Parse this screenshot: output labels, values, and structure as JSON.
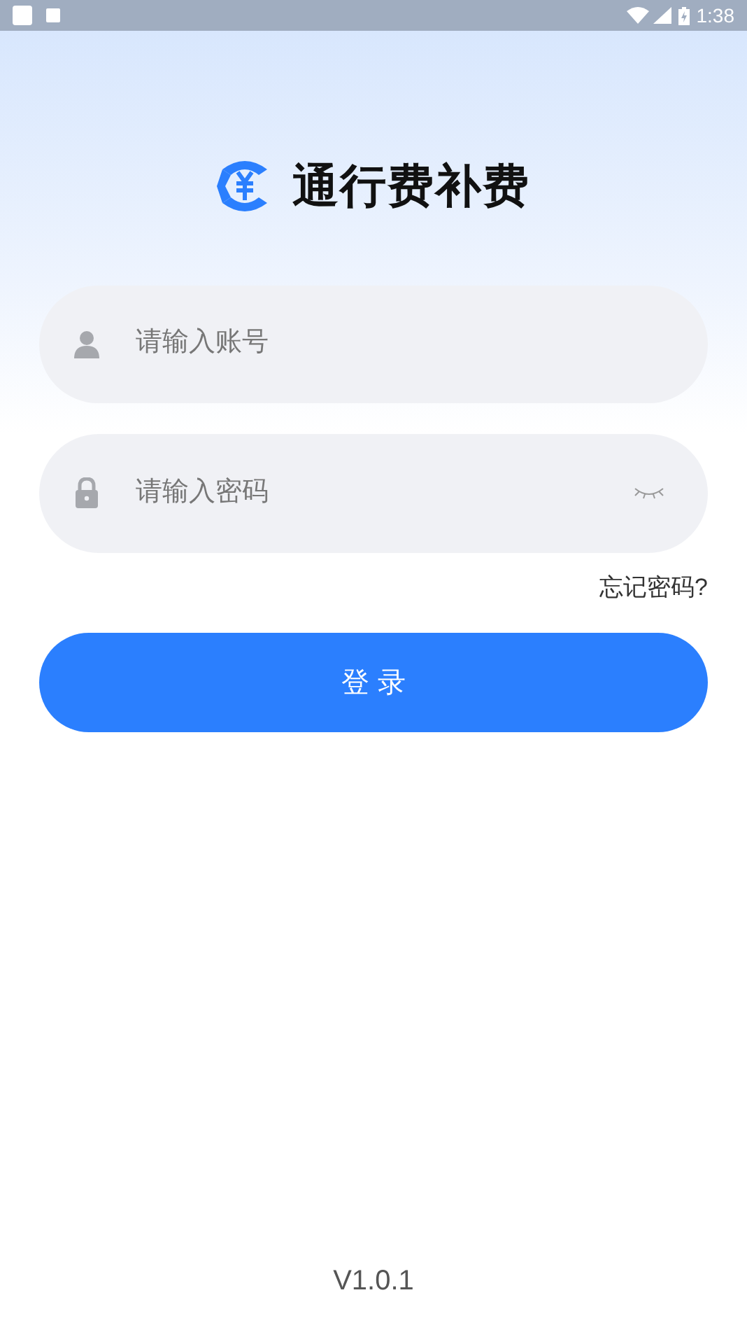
{
  "status_bar": {
    "time": "1:38"
  },
  "app_title": "通行费补费",
  "account_field": {
    "placeholder": "请输入账号"
  },
  "password_field": {
    "placeholder": "请输入密码",
    "visible": false
  },
  "forgot_password": "忘记密码?",
  "login_button": "登 录",
  "version": "V1.0.1"
}
